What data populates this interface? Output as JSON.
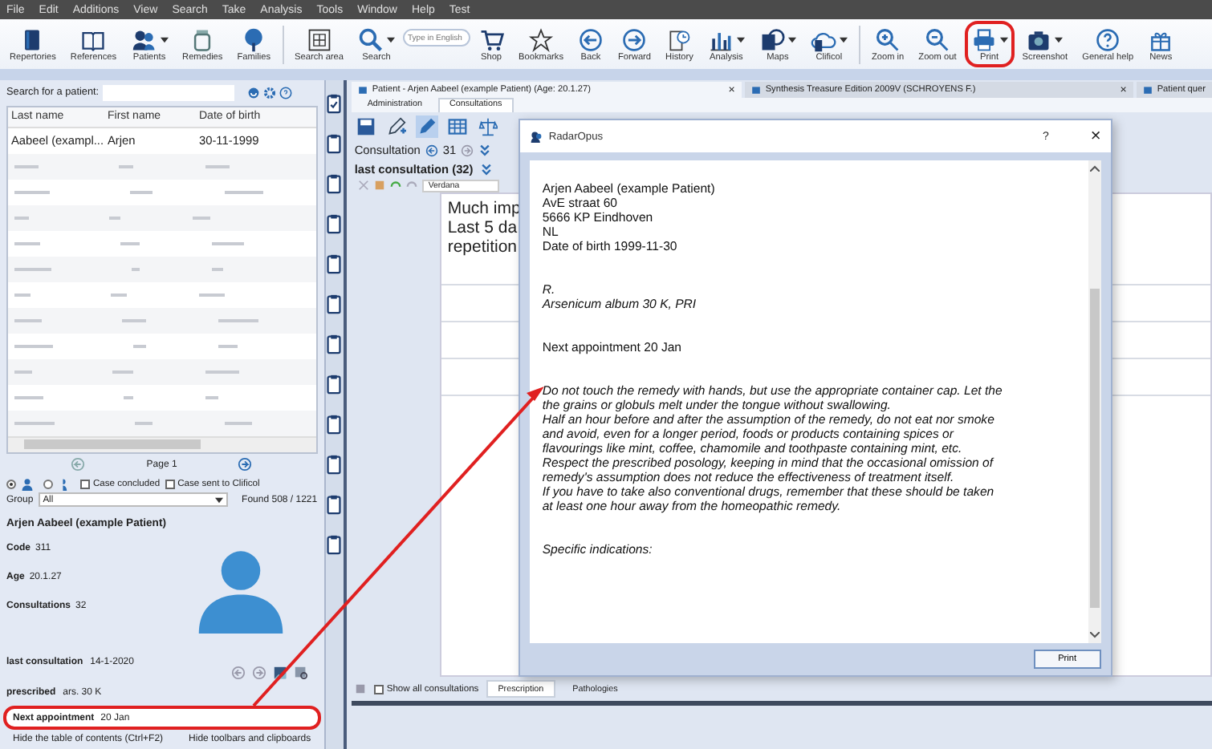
{
  "menu": [
    "File",
    "Edit",
    "Additions",
    "View",
    "Search",
    "Take",
    "Analysis",
    "Tools",
    "Window",
    "Help",
    "Test"
  ],
  "toolbar": [
    {
      "kind": "button",
      "label": "Repertories",
      "dropdown": false,
      "annotated": false
    },
    {
      "kind": "button",
      "label": "References",
      "dropdown": false,
      "annotated": false
    },
    {
      "kind": "button",
      "label": "Patients",
      "dropdown": true,
      "annotated": false
    },
    {
      "kind": "button",
      "label": "Remedies",
      "dropdown": false,
      "annotated": false
    },
    {
      "kind": "button",
      "label": "Families",
      "dropdown": false,
      "annotated": false
    },
    {
      "kind": "separator"
    },
    {
      "kind": "button",
      "label": "Search area",
      "dropdown": false,
      "annotated": false
    },
    {
      "kind": "button",
      "label": "Search",
      "dropdown": true,
      "annotated": false
    },
    {
      "kind": "field",
      "placeholder": "Type in English"
    },
    {
      "kind": "button",
      "label": "Shop",
      "dropdown": false,
      "annotated": false
    },
    {
      "kind": "button",
      "label": "Bookmarks",
      "dropdown": false,
      "annotated": false
    },
    {
      "kind": "button",
      "label": "Back",
      "dropdown": false,
      "annotated": false
    },
    {
      "kind": "button",
      "label": "Forward",
      "dropdown": false,
      "annotated": false
    },
    {
      "kind": "button",
      "label": "History",
      "dropdown": false,
      "annotated": false
    },
    {
      "kind": "button",
      "label": "Analysis",
      "dropdown": true,
      "annotated": false
    },
    {
      "kind": "button",
      "label": "Maps",
      "dropdown": true,
      "annotated": false
    },
    {
      "kind": "button",
      "label": "Clificol",
      "dropdown": true,
      "annotated": false
    },
    {
      "kind": "separator"
    },
    {
      "kind": "button",
      "label": "Zoom in",
      "dropdown": false,
      "annotated": false
    },
    {
      "kind": "button",
      "label": "Zoom out",
      "dropdown": false,
      "annotated": false
    },
    {
      "kind": "button",
      "label": "Print",
      "dropdown": true,
      "annotated": true
    },
    {
      "kind": "button",
      "label": "Screenshot",
      "dropdown": true,
      "annotated": false
    },
    {
      "kind": "button",
      "label": "General help",
      "dropdown": false,
      "annotated": false
    },
    {
      "kind": "button",
      "label": "News",
      "dropdown": false,
      "annotated": false
    }
  ],
  "left_panel": {
    "search_label": "Search for a patient:",
    "table": {
      "columns": [
        "Last name",
        "First name",
        "Date of birth"
      ],
      "rows": [
        {
          "kind": "text",
          "selected": false,
          "cells": [
            "Aabeel (exampl...",
            "Arjen",
            "30-11-1999"
          ]
        },
        {
          "kind": "blurred"
        },
        {
          "kind": "blurred"
        },
        {
          "kind": "blurred"
        },
        {
          "kind": "blurred"
        },
        {
          "kind": "blurred"
        },
        {
          "kind": "blurred"
        },
        {
          "kind": "blurred"
        },
        {
          "kind": "blurred"
        },
        {
          "kind": "blurred"
        },
        {
          "kind": "blurred"
        },
        {
          "kind": "blurred"
        }
      ]
    },
    "pager": "Page 1",
    "radios": [
      {
        "selected": true
      },
      {
        "selected": false
      }
    ],
    "checkboxes": [
      {
        "label": "Case concluded",
        "checked": false
      },
      {
        "label": "Case sent to Clificol",
        "checked": false
      }
    ],
    "group_label": "Group",
    "group_value": "All",
    "found": "Found 508 / 1221",
    "patient": {
      "name": "Arjen Aabeel (example Patient)",
      "fields": [
        {
          "label": "Code",
          "value": "311"
        },
        {
          "label": "Age",
          "value": "20.1.27"
        },
        {
          "label": "Consultations",
          "value": "32"
        }
      ],
      "last_consultation_label": "last consultation",
      "last_consultation": "14-1-2020",
      "prescribed_label": "prescribed",
      "prescribed": "ars. 30 K",
      "next_appointment_label": "Next appointment",
      "next_appointment": "20 Jan",
      "annotated": true
    },
    "footer": [
      "Hide the table of contents (Ctrl+F2)",
      "Hide toolbars and clipboards"
    ]
  },
  "clipboards": [
    {
      "checked": true
    },
    {
      "checked": false
    },
    {
      "checked": false
    },
    {
      "checked": false
    },
    {
      "checked": false
    },
    {
      "checked": false
    },
    {
      "checked": false
    },
    {
      "checked": false
    },
    {
      "checked": false
    },
    {
      "checked": false
    },
    {
      "checked": false
    },
    {
      "checked": false
    }
  ],
  "main": {
    "tabs": [
      {
        "label": "Patient - Arjen Aabeel (example Patient) (Age: 20.1.27)",
        "selected": true,
        "close": "×"
      },
      {
        "label": "Synthesis Treasure Edition 2009V (SCHROYENS F.)",
        "selected": false,
        "close": "×"
      },
      {
        "label": "Patient quer",
        "selected": false
      }
    ],
    "subtabs": [
      {
        "label": "Administration",
        "selected": false
      },
      {
        "label": "Consultations",
        "selected": true
      }
    ],
    "consultation_label": "Consultation",
    "consultation_number": "31",
    "last_consultation": "last consultation (32)",
    "font": "Verdana",
    "notes": [
      "Much imp",
      "Last 5 da",
      "repetition"
    ],
    "show_all": {
      "label": "Show all consultations",
      "checked": false
    },
    "bottom_tabs": [
      {
        "label": "Prescription",
        "selected": true
      },
      {
        "label": "Pathologies",
        "selected": false
      }
    ]
  },
  "dialog": {
    "title": "RadarOpus",
    "help": "?",
    "close": "×",
    "button": "Print",
    "lines": [
      {
        "kind": "gap"
      },
      {
        "kind": "plain",
        "text": "Arjen Aabeel (example Patient)"
      },
      {
        "kind": "plain",
        "text": "AvE straat 60"
      },
      {
        "kind": "plain",
        "text": "5666 KP Eindhoven"
      },
      {
        "kind": "plain",
        "text": "NL"
      },
      {
        "kind": "plain",
        "text": "Date of birth 1999-11-30"
      },
      {
        "kind": "gap"
      },
      {
        "kind": "gap"
      },
      {
        "kind": "italic",
        "text": "R."
      },
      {
        "kind": "italic",
        "text": "Arsenicum album 30 K, PRI"
      },
      {
        "kind": "gap"
      },
      {
        "kind": "gap"
      },
      {
        "kind": "plain",
        "text": "Next appointment 20 Jan"
      },
      {
        "kind": "gap"
      },
      {
        "kind": "gap"
      },
      {
        "kind": "italic",
        "text": "Do not touch the remedy with hands, but use the appropriate container cap. Let the"
      },
      {
        "kind": "italic",
        "text": "the grains or globuls melt under the tongue without swallowing."
      },
      {
        "kind": "italic",
        "text": "Half an hour before and after the assumption of the remedy, do not eat nor smoke"
      },
      {
        "kind": "italic",
        "text": "and avoid, even for a longer period, foods or products containing spices or"
      },
      {
        "kind": "italic",
        "text": "flavourings like mint, coffee, chamomile and toothpaste containing mint, etc."
      },
      {
        "kind": "italic",
        "text": "Respect the prescribed posology, keeping in mind that the occasional omission of"
      },
      {
        "kind": "italic",
        "text": "remedy's assumption does not reduce the effectiveness of treatment itself."
      },
      {
        "kind": "italic",
        "text": "If you have to take also conventional drugs, remember that these should be taken"
      },
      {
        "kind": "italic",
        "text": "at least one hour away from the homeopathic remedy."
      },
      {
        "kind": "gap"
      },
      {
        "kind": "gap"
      },
      {
        "kind": "italic",
        "text": "Specific indications:"
      }
    ]
  }
}
